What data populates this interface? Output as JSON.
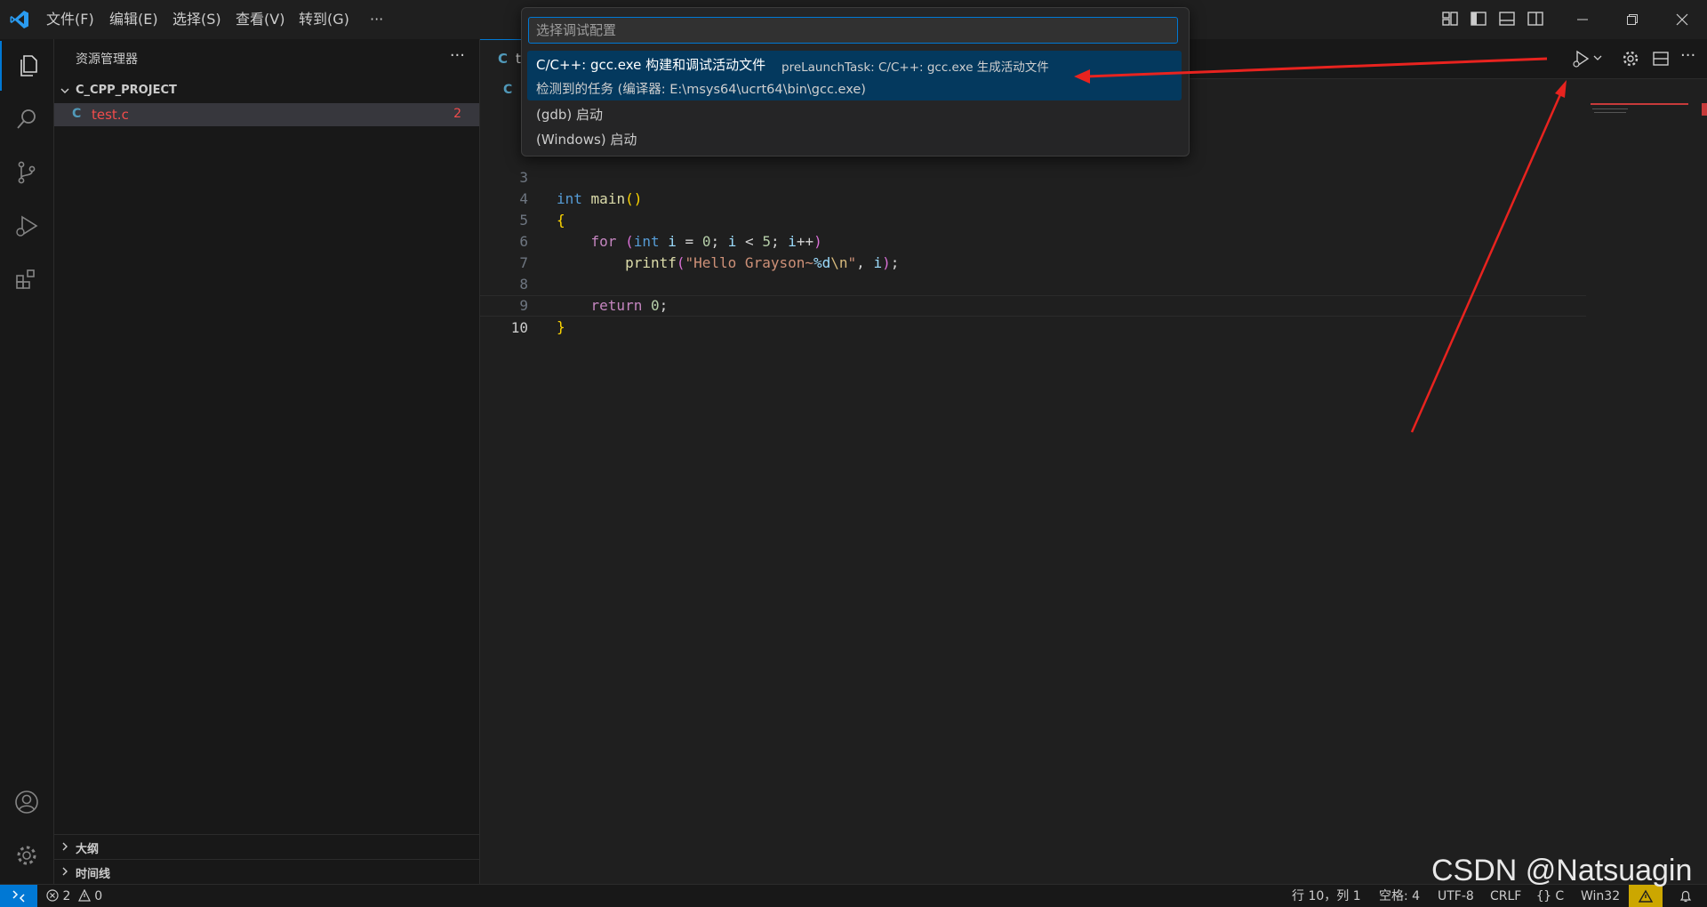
{
  "titlebar": {
    "menus": [
      "文件(F)",
      "编辑(E)",
      "选择(S)",
      "查看(V)",
      "转到(G)",
      "···"
    ]
  },
  "sidebar": {
    "title": "资源管理器",
    "more": "···",
    "folder": "C_CPP_PROJECT",
    "files": [
      {
        "icon": "C",
        "name": "test.c",
        "badge": "2"
      }
    ],
    "sections": [
      "大纲",
      "时间线"
    ]
  },
  "editor": {
    "tab_icon": "C",
    "tab_label": "t",
    "crumb_icon": "C",
    "lines": [
      {
        "n": "3"
      },
      {
        "n": "4"
      },
      {
        "n": "5"
      },
      {
        "n": "6"
      },
      {
        "n": "7"
      },
      {
        "n": "8"
      },
      {
        "n": "9"
      },
      {
        "n": "10"
      }
    ]
  },
  "quickpick": {
    "placeholder": "选择调试配置",
    "items": [
      {
        "label": "C/C++: gcc.exe 构建和调试活动文件",
        "description": "preLaunchTask: C/C++: gcc.exe 生成活动文件",
        "detail": "检测到的任务 (编译器: E:\\msys64\\ucrt64\\bin\\gcc.exe)",
        "selected": true
      },
      {
        "label": "(gdb) 启动"
      },
      {
        "label": "(Windows) 启动"
      }
    ]
  },
  "statusbar": {
    "errors": "2",
    "warnings": "0",
    "position": "行 10，列 1",
    "spaces": "空格: 4",
    "encoding": "UTF-8",
    "eol": "CRLF",
    "language": "C",
    "platform": "Win32"
  },
  "watermark": "CSDN @Natsuagin",
  "colors": {
    "accent": "#0078d4",
    "selection": "#04395e",
    "error_file": "#f14c4c",
    "annotation_arrow": "#e8231f"
  }
}
